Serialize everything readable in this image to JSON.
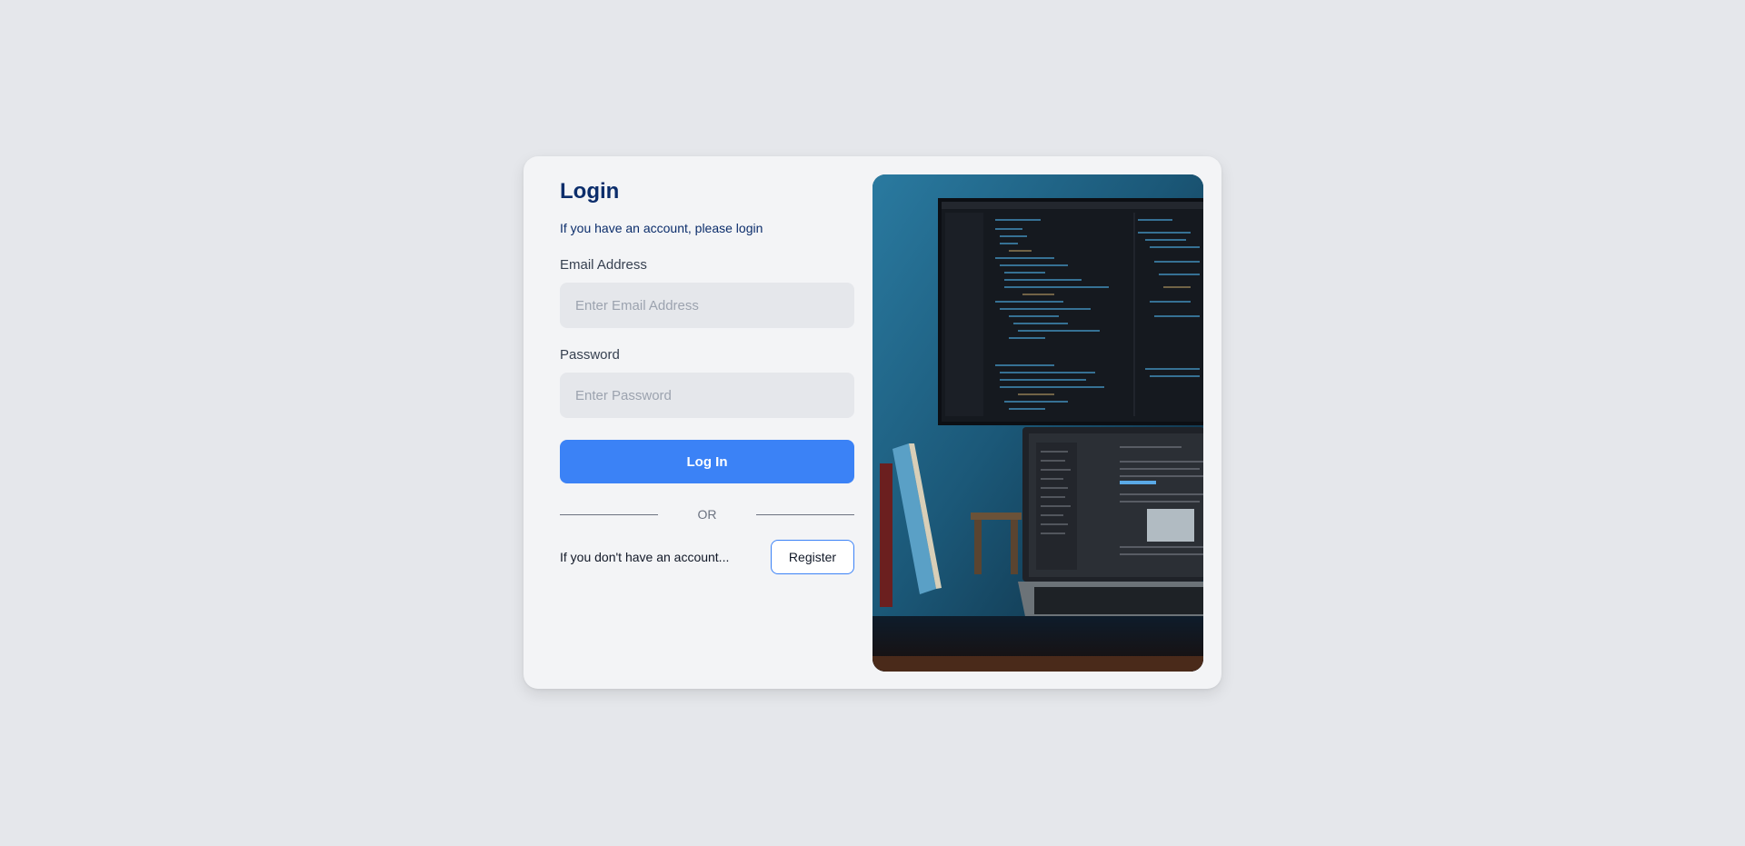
{
  "login": {
    "title": "Login",
    "subtitle": "If you have an account, please login",
    "email_label": "Email Address",
    "email_placeholder": "Enter Email Address",
    "email_value": "",
    "password_label": "Password",
    "password_placeholder": "Enter Password",
    "password_value": "",
    "submit_label": "Log In",
    "divider_text": "OR",
    "register_prompt": "If you don't have an account...",
    "register_label": "Register"
  },
  "colors": {
    "page_background": "#e5e7eb",
    "card_background": "#f3f4f6",
    "title": "#0b2d6b",
    "primary_button": "#3b82f6",
    "input_background": "#e5e7eb"
  }
}
